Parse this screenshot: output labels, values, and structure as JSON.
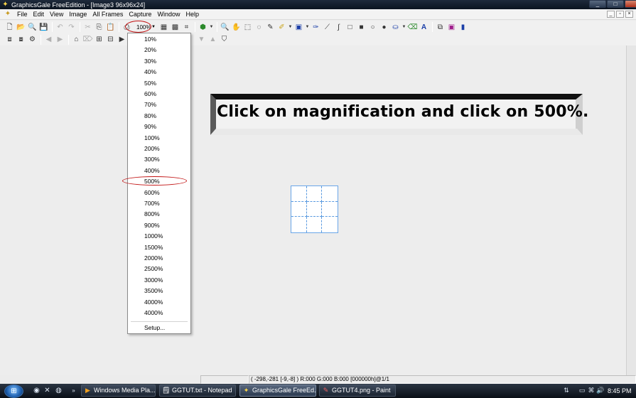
{
  "window": {
    "title": "GraphicsGale FreeEdition - [Image3 96x96x24]",
    "controls": {
      "minimize": "_",
      "maximize": "□",
      "close": "✕"
    }
  },
  "menu": {
    "items": [
      "File",
      "Edit",
      "View",
      "Image",
      "All Frames",
      "Capture",
      "Window",
      "Help"
    ]
  },
  "toolbar": {
    "zoom_value": "100%",
    "icons": [
      "new-file-icon",
      "open-folder-icon",
      "magnifier-icon",
      "save-icon",
      "undo-icon",
      "redo-icon",
      "cut-icon",
      "copy-icon",
      "paste-icon",
      "scanner-icon",
      "zoom-dropdown",
      "grid-icon",
      "pixel-grid-icon",
      "crop-icon",
      "color-select-icon",
      "zoom-tool-icon",
      "hand-tool-icon",
      "rect-select-icon",
      "lasso-icon",
      "magic-wand-icon",
      "dropper-icon",
      "fill-select-icon",
      "brush-icon",
      "line-icon",
      "curve-icon",
      "rectangle-icon",
      "filled-rectangle-icon",
      "ellipse-icon",
      "filled-ellipse-icon",
      "fill-bucket-icon",
      "eraser-icon",
      "text-icon",
      "layer-icon",
      "frame-icon",
      "pen-icon"
    ]
  },
  "zoom_menu": {
    "options": [
      "10%",
      "20%",
      "30%",
      "40%",
      "50%",
      "60%",
      "70%",
      "80%",
      "90%",
      "100%",
      "200%",
      "300%",
      "400%",
      "500%",
      "600%",
      "700%",
      "800%",
      "900%",
      "1000%",
      "1500%",
      "2000%",
      "2500%",
      "3000%",
      "3500%",
      "4000%",
      "4000%"
    ],
    "setup_label": "Setup...",
    "highlighted": "500%"
  },
  "instruction": {
    "text": "Click on magnification and click on 500%."
  },
  "statusbar": {
    "coords": "( -298,-281 [-9,-8] ) R:000 G:000 B:000  [000000h]@1/1"
  },
  "taskbar": {
    "tasks": [
      {
        "label": "Windows Media Pla...",
        "icon": "media-player-icon",
        "active": false
      },
      {
        "label": "GGTUT.txt - Notepad",
        "icon": "notepad-icon",
        "active": false
      },
      {
        "label": "GraphicsGale FreeEd...",
        "icon": "graphicsgale-icon",
        "active": true
      },
      {
        "label": "GGTUT4.png - Paint",
        "icon": "paint-icon",
        "active": false
      }
    ],
    "clock": "8:45 PM"
  },
  "colors": {
    "annotation_ring": "#c21414",
    "grid_line": "#5a9ae0",
    "titlebar": "#0b1420"
  }
}
